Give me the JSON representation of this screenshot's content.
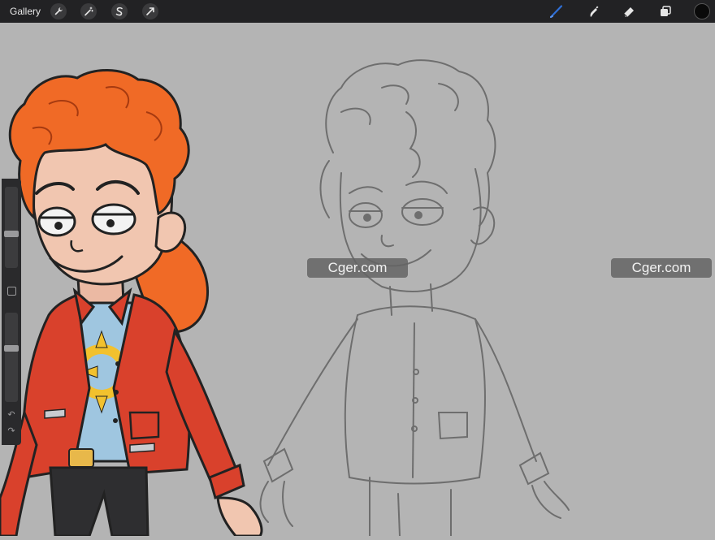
{
  "toolbar": {
    "gallery_label": "Gallery",
    "left_tools": [
      "wrench-icon",
      "magic-wand-icon",
      "selection-icon",
      "transform-arrow-icon"
    ],
    "right_tools": [
      "brush-icon",
      "smudge-icon",
      "eraser-icon",
      "layers-icon"
    ],
    "brush_color": "#2f6fd6",
    "current_color": "#0a0a0a"
  },
  "watermarks": {
    "left": "Cger.com",
    "right": "Cger.com"
  },
  "colors": {
    "canvas_bg": "#b4b4b4",
    "hair": "#f06a26",
    "jacket": "#d9412c",
    "shirt": "#9fc6e0",
    "sun": "#f2c12e",
    "skin": "#f1c6b0"
  }
}
